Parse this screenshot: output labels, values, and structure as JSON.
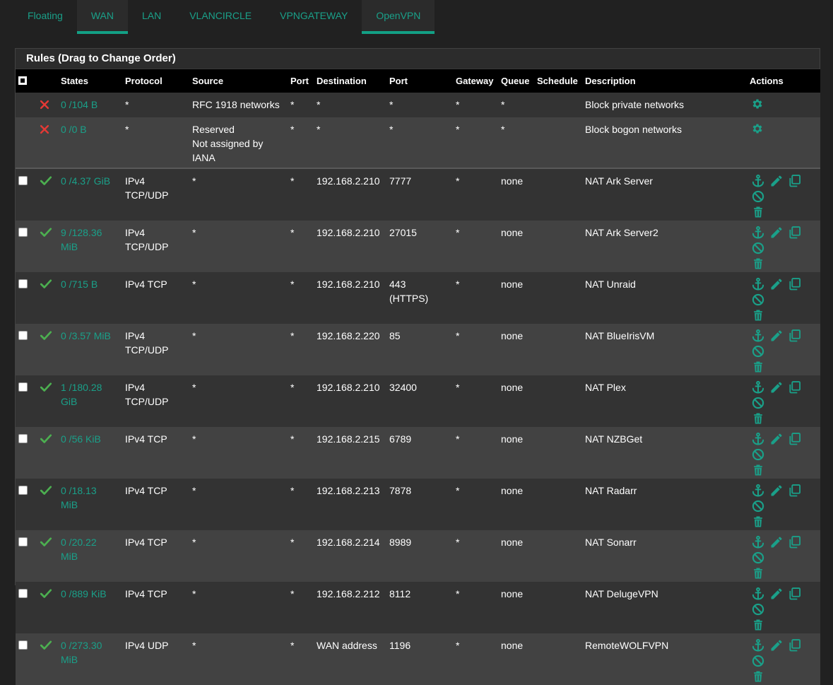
{
  "tabs": [
    {
      "label": "Floating",
      "active": false
    },
    {
      "label": "WAN",
      "active": true
    },
    {
      "label": "LAN",
      "active": false
    },
    {
      "label": "VLANCIRCLE",
      "active": false
    },
    {
      "label": "VPNGATEWAY",
      "active": false
    },
    {
      "label": "OpenVPN",
      "active": true
    }
  ],
  "panel": {
    "title": "Rules (Drag to Change Order)"
  },
  "columns": {
    "states": "States",
    "protocol": "Protocol",
    "source": "Source",
    "src_port": "Port",
    "destination": "Destination",
    "dst_port": "Port",
    "gateway": "Gateway",
    "queue": "Queue",
    "schedule": "Schedule",
    "description": "Description",
    "actions": "Actions"
  },
  "colors": {
    "accent": "#1aa089",
    "pass": "#4caf50",
    "block": "#e53935"
  },
  "rules": [
    {
      "type": "block",
      "checkbox": false,
      "states": "0 /104 B",
      "protocol": "*",
      "source": "RFC 1918 networks",
      "src_port": "*",
      "destination": "*",
      "dst_port": "*",
      "gateway": "*",
      "queue": "*",
      "schedule": "",
      "description": "Block private networks",
      "actions": [
        "gear-icon"
      ]
    },
    {
      "type": "block",
      "checkbox": false,
      "states": "0 /0 B",
      "protocol": "*",
      "source": "Reserved\nNot assigned by\nIANA",
      "src_port": "*",
      "destination": "*",
      "dst_port": "*",
      "gateway": "*",
      "queue": "*",
      "schedule": "",
      "description": "Block bogon networks",
      "actions": [
        "gear-icon"
      ]
    },
    {
      "type": "pass",
      "checkbox": true,
      "states": "0 /4.37 GiB",
      "protocol": "IPv4\nTCP/UDP",
      "source": "*",
      "src_port": "*",
      "destination": "192.168.2.210",
      "dst_port": "7777",
      "gateway": "*",
      "queue": "none",
      "schedule": "",
      "description": "NAT Ark Server",
      "actions": [
        "anchor-icon",
        "pencil-icon",
        "copy-icon",
        "disable-icon",
        "trash-icon"
      ]
    },
    {
      "type": "pass",
      "checkbox": true,
      "states": "9 /128.36\nMiB",
      "protocol": "IPv4\nTCP/UDP",
      "source": "*",
      "src_port": "*",
      "destination": "192.168.2.210",
      "dst_port": "27015",
      "gateway": "*",
      "queue": "none",
      "schedule": "",
      "description": "NAT Ark Server2",
      "actions": [
        "anchor-icon",
        "pencil-icon",
        "copy-icon",
        "disable-icon",
        "trash-icon"
      ]
    },
    {
      "type": "pass",
      "checkbox": true,
      "states": "0 /715 B",
      "protocol": "IPv4 TCP",
      "source": "*",
      "src_port": "*",
      "destination": "192.168.2.210",
      "dst_port": "443\n(HTTPS)",
      "gateway": "*",
      "queue": "none",
      "schedule": "",
      "description": "NAT Unraid",
      "actions": [
        "anchor-icon",
        "pencil-icon",
        "copy-icon",
        "disable-icon",
        "trash-icon"
      ]
    },
    {
      "type": "pass",
      "checkbox": true,
      "states": "0 /3.57 MiB",
      "protocol": "IPv4\nTCP/UDP",
      "source": "*",
      "src_port": "*",
      "destination": "192.168.2.220",
      "dst_port": "85",
      "gateway": "*",
      "queue": "none",
      "schedule": "",
      "description": "NAT BlueIrisVM",
      "actions": [
        "anchor-icon",
        "pencil-icon",
        "copy-icon",
        "disable-icon",
        "trash-icon"
      ]
    },
    {
      "type": "pass",
      "checkbox": true,
      "states": "1 /180.28\nGiB",
      "protocol": "IPv4\nTCP/UDP",
      "source": "*",
      "src_port": "*",
      "destination": "192.168.2.210",
      "dst_port": "32400",
      "gateway": "*",
      "queue": "none",
      "schedule": "",
      "description": "NAT Plex",
      "actions": [
        "anchor-icon",
        "pencil-icon",
        "copy-icon",
        "disable-icon",
        "trash-icon"
      ]
    },
    {
      "type": "pass",
      "checkbox": true,
      "states": "0 /56 KiB",
      "protocol": "IPv4 TCP",
      "source": "*",
      "src_port": "*",
      "destination": "192.168.2.215",
      "dst_port": "6789",
      "gateway": "*",
      "queue": "none",
      "schedule": "",
      "description": "NAT NZBGet",
      "actions": [
        "anchor-icon",
        "pencil-icon",
        "copy-icon",
        "disable-icon",
        "trash-icon"
      ]
    },
    {
      "type": "pass",
      "checkbox": true,
      "states": "0 /18.13\nMiB",
      "protocol": "IPv4 TCP",
      "source": "*",
      "src_port": "*",
      "destination": "192.168.2.213",
      "dst_port": "7878",
      "gateway": "*",
      "queue": "none",
      "schedule": "",
      "description": "NAT Radarr",
      "actions": [
        "anchor-icon",
        "pencil-icon",
        "copy-icon",
        "disable-icon",
        "trash-icon"
      ]
    },
    {
      "type": "pass",
      "checkbox": true,
      "states": "0 /20.22\nMiB",
      "protocol": "IPv4 TCP",
      "source": "*",
      "src_port": "*",
      "destination": "192.168.2.214",
      "dst_port": "8989",
      "gateway": "*",
      "queue": "none",
      "schedule": "",
      "description": "NAT Sonarr",
      "actions": [
        "anchor-icon",
        "pencil-icon",
        "copy-icon",
        "disable-icon",
        "trash-icon"
      ]
    },
    {
      "type": "pass",
      "checkbox": true,
      "states": "0 /889 KiB",
      "protocol": "IPv4 TCP",
      "source": "*",
      "src_port": "*",
      "destination": "192.168.2.212",
      "dst_port": "8112",
      "gateway": "*",
      "queue": "none",
      "schedule": "",
      "description": "NAT DelugeVPN",
      "actions": [
        "anchor-icon",
        "pencil-icon",
        "copy-icon",
        "disable-icon",
        "trash-icon"
      ]
    },
    {
      "type": "pass",
      "checkbox": true,
      "states": "0 /273.30\nMiB",
      "protocol": "IPv4 UDP",
      "source": "*",
      "src_port": "*",
      "destination": "WAN address",
      "dst_port": "1196",
      "gateway": "*",
      "queue": "none",
      "schedule": "",
      "description": "RemoteWOLFVPN",
      "actions": [
        "anchor-icon",
        "pencil-icon",
        "copy-icon",
        "disable-icon",
        "trash-icon"
      ]
    }
  ]
}
